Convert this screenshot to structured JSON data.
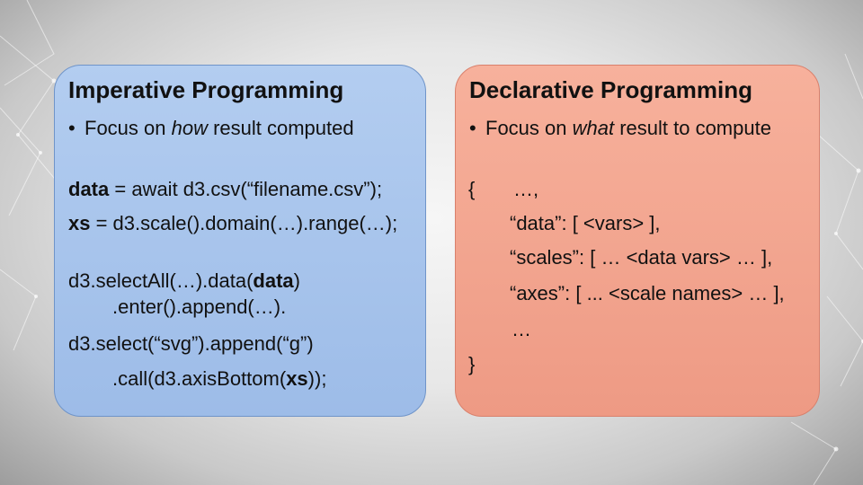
{
  "left_panel": {
    "title": "Imperative Programming",
    "bullet_prefix": "Focus on ",
    "bullet_em": "how",
    "bullet_suffix": " result computed",
    "lines": {
      "l1_kw": "data",
      "l1_rest": " = await d3.csv(“filename.csv”);",
      "l2_kw": "xs",
      "l2_rest": " = d3.scale().domain(…).range(…);",
      "l3_pre": "d3.selectAll(…).data(",
      "l3_kw": "data",
      "l3_post": ")",
      "l4": ".enter().append(…).",
      "l5": "d3.select(“svg”).append(“g”)",
      "l6_pre": ".call(d3.axisBottom(",
      "l6_kw": "xs",
      "l6_post": "));"
    }
  },
  "right_panel": {
    "title": "Declarative Programming",
    "bullet_prefix": "Focus on ",
    "bullet_em": "what",
    "bullet_suffix": " result to compute",
    "lines": {
      "open_brace": "{",
      "l1": "…,",
      "l2": "“data”: [ <vars> ],",
      "l3": "“scales”: [ … <data vars> … ],",
      "l4": "“axes”: [ ... <scale names> … ],",
      "l5": "…",
      "close_brace": "}"
    }
  },
  "colors": {
    "left_panel_bg": "#a9c6ee",
    "right_panel_bg": "#f3a690",
    "text": "#111111"
  }
}
